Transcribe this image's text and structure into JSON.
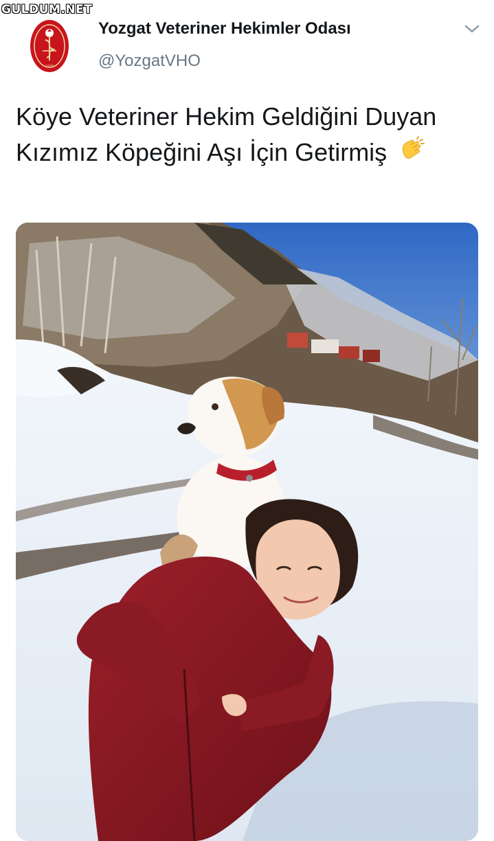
{
  "watermark": "GULDUM.NET",
  "tweet": {
    "author": {
      "display_name": "Yozgat Veteriner Hekimler Odası",
      "handle": "@YozgatVHO",
      "avatar_icon": "veterinary-emblem-logo"
    },
    "menu_icon": "chevron-down-icon",
    "text": "Köye Veteriner Hekim Geldiğini Duyan Kızımız Köpeğini Aşı İçin Getirmiş",
    "emoji": "clapping-hands-icon",
    "media": {
      "type": "photo",
      "subject": "girl carrying dog on her back in snowy village road"
    }
  },
  "colors": {
    "name": "#14171a",
    "handle": "#657786",
    "emblem_red": "#c0141c",
    "sky": "#3d73c8",
    "snow": "#eef3f8"
  }
}
